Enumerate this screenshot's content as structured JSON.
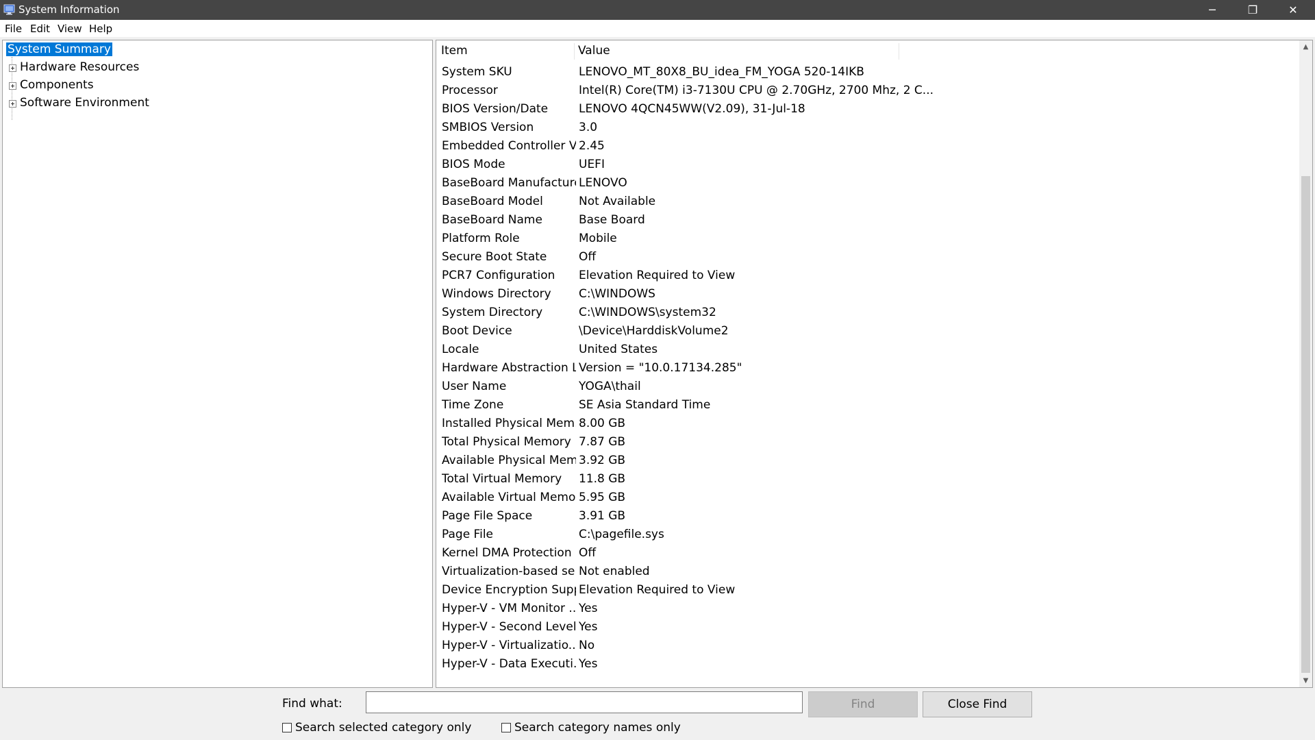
{
  "window": {
    "title": "System Information",
    "icon": "system-info-icon",
    "controls": {
      "minimize": "─",
      "maximize": "❐",
      "close": "✕"
    }
  },
  "menu": [
    "File",
    "Edit",
    "View",
    "Help"
  ],
  "tree": {
    "selected": "System Summary",
    "nodes": [
      "Hardware Resources",
      "Components",
      "Software Environment"
    ]
  },
  "table": {
    "headers": {
      "item": "Item",
      "value": "Value"
    },
    "rows": [
      [
        "System SKU",
        "LENOVO_MT_80X8_BU_idea_FM_YOGA 520-14IKB"
      ],
      [
        "Processor",
        "Intel(R) Core(TM) i3-7130U CPU @ 2.70GHz, 2700 Mhz, 2 C..."
      ],
      [
        "BIOS Version/Date",
        "LENOVO 4QCN45WW(V2.09), 31-Jul-18"
      ],
      [
        "SMBIOS Version",
        "3.0"
      ],
      [
        "Embedded Controller V...",
        "2.45"
      ],
      [
        "BIOS Mode",
        "UEFI"
      ],
      [
        "BaseBoard Manufacturer",
        "LENOVO"
      ],
      [
        "BaseBoard Model",
        "Not Available"
      ],
      [
        "BaseBoard Name",
        "Base Board"
      ],
      [
        "Platform Role",
        "Mobile"
      ],
      [
        "Secure Boot State",
        "Off"
      ],
      [
        "PCR7 Configuration",
        "Elevation Required to View"
      ],
      [
        "Windows Directory",
        "C:\\WINDOWS"
      ],
      [
        "System Directory",
        "C:\\WINDOWS\\system32"
      ],
      [
        "Boot Device",
        "\\Device\\HarddiskVolume2"
      ],
      [
        "Locale",
        "United States"
      ],
      [
        "Hardware Abstraction L...",
        "Version = \"10.0.17134.285\""
      ],
      [
        "User Name",
        "YOGA\\thail"
      ],
      [
        "Time Zone",
        "SE Asia Standard Time"
      ],
      [
        "Installed Physical Mem...",
        "8.00 GB"
      ],
      [
        "Total Physical Memory",
        "7.87 GB"
      ],
      [
        "Available Physical Mem",
        "3.92 GB"
      ],
      [
        "Total Virtual Memory",
        "11.8 GB"
      ],
      [
        "Available Virtual Memory",
        "5.95 GB"
      ],
      [
        "Page File Space",
        "3.91 GB"
      ],
      [
        "Page File",
        "C:\\pagefile.sys"
      ],
      [
        "Kernel DMA Protection",
        "Off"
      ],
      [
        "Virtualization-based se...",
        "Not enabled"
      ],
      [
        "Device Encryption Supp",
        "Elevation Required to View"
      ],
      [
        "Hyper-V - VM Monitor ...",
        "Yes"
      ],
      [
        "Hyper-V - Second Level...",
        "Yes"
      ],
      [
        "Hyper-V - Virtualizatio...",
        "No"
      ],
      [
        "Hyper-V - Data Executi...",
        "Yes"
      ]
    ]
  },
  "find": {
    "label": "Find what:",
    "value": "",
    "find_button": "Find",
    "close_button": "Close Find",
    "option_selected_category": "Search selected category only",
    "option_category_names": "Search category names only"
  },
  "scrollbar": {
    "up": "▲",
    "down": "▼"
  }
}
